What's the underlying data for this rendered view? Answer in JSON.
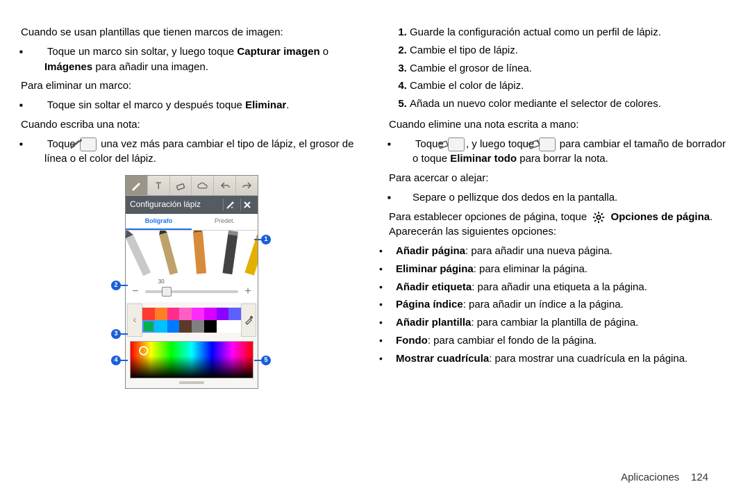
{
  "left": {
    "p1_a": "Cuando se usan plantillas que tienen marcos de imagen:",
    "p1_bullet": "Toque un marco sin soltar, y luego toque ",
    "p1_bold1": "Capturar imagen",
    "p1_mid": " o ",
    "p1_bold2": "Imágenes",
    "p1_end": " para añadir una imagen.",
    "p2": "Para eliminar un marco:",
    "p2_bullet_a": "Toque sin soltar el marco y después toque ",
    "p2_bullet_bold": "Eliminar",
    "p2_bullet_end": ".",
    "p3": "Cuando escriba una nota:",
    "p3_bullet_a": "Toque ",
    "p3_bullet_b": " una vez más para cambiar el tipo de lápiz, el grosor de línea o el color del lápiz."
  },
  "right": {
    "ol": [
      "Guarde la configuración actual como un perfil de lápiz.",
      "Cambie el tipo de lápiz.",
      "Cambie el grosor de línea.",
      "Cambie el color de lápiz.",
      "Añada un nuevo color mediante el selector de colores."
    ],
    "p_del": "Cuando elimine una nota escrita a mano:",
    "del_bullet_a": "Toque ",
    "del_bullet_b": ", y luego toque ",
    "del_bullet_c": " para cambiar el tamaño de borrador o toque ",
    "del_bullet_bold": "Eliminar todo",
    "del_bullet_end": " para borrar la nota.",
    "p_zoom": "Para acercar o alejar:",
    "zoom_bullet": "Separe o pellizque dos dedos en la pantalla.",
    "opts_a": "Para establecer opciones de página, toque ",
    "opts_bold1": "Opciones de página",
    "opts_b": ". Aparecerán las siguientes opciones:",
    "opts_list": [
      {
        "bold": "Añadir página",
        "rest": ": para añadir una nueva página."
      },
      {
        "bold": "Eliminar página",
        "rest": ": para eliminar la página."
      },
      {
        "bold": "Añadir etiqueta",
        "rest": ": para añadir una etiqueta a la página."
      },
      {
        "bold": "Página índice",
        "rest": ": para añadir un índice a la página."
      },
      {
        "bold": "Añadir plantilla",
        "rest": ": para cambiar la plantilla de página."
      },
      {
        "bold": "Fondo",
        "rest": ": para cambiar el fondo de la página."
      },
      {
        "bold": "Mostrar cuadrícula",
        "rest": ": para mostrar una cuadrícula en la página."
      }
    ]
  },
  "phone": {
    "header": "Configuración lápiz",
    "tabs": [
      "Bolígrafo",
      "Predet."
    ],
    "slider_value": "30",
    "swatches": [
      "#ff3b30",
      "#ff7f27",
      "#ff2e8b",
      "#ff5fc5",
      "#ff2aff",
      "#d900ff",
      "#8b00ff",
      "#5f5fff",
      "#00b050",
      "#00c0ff",
      "#007aff",
      "#5b3a29",
      "#808080",
      "#000000",
      "#ffffff",
      "#ffffff"
    ],
    "selected_swatch": 8
  },
  "callouts": {
    "1": "1",
    "2": "2",
    "3": "3",
    "4": "4",
    "5": "5"
  },
  "footer": {
    "section": "Aplicaciones",
    "page": "124"
  }
}
